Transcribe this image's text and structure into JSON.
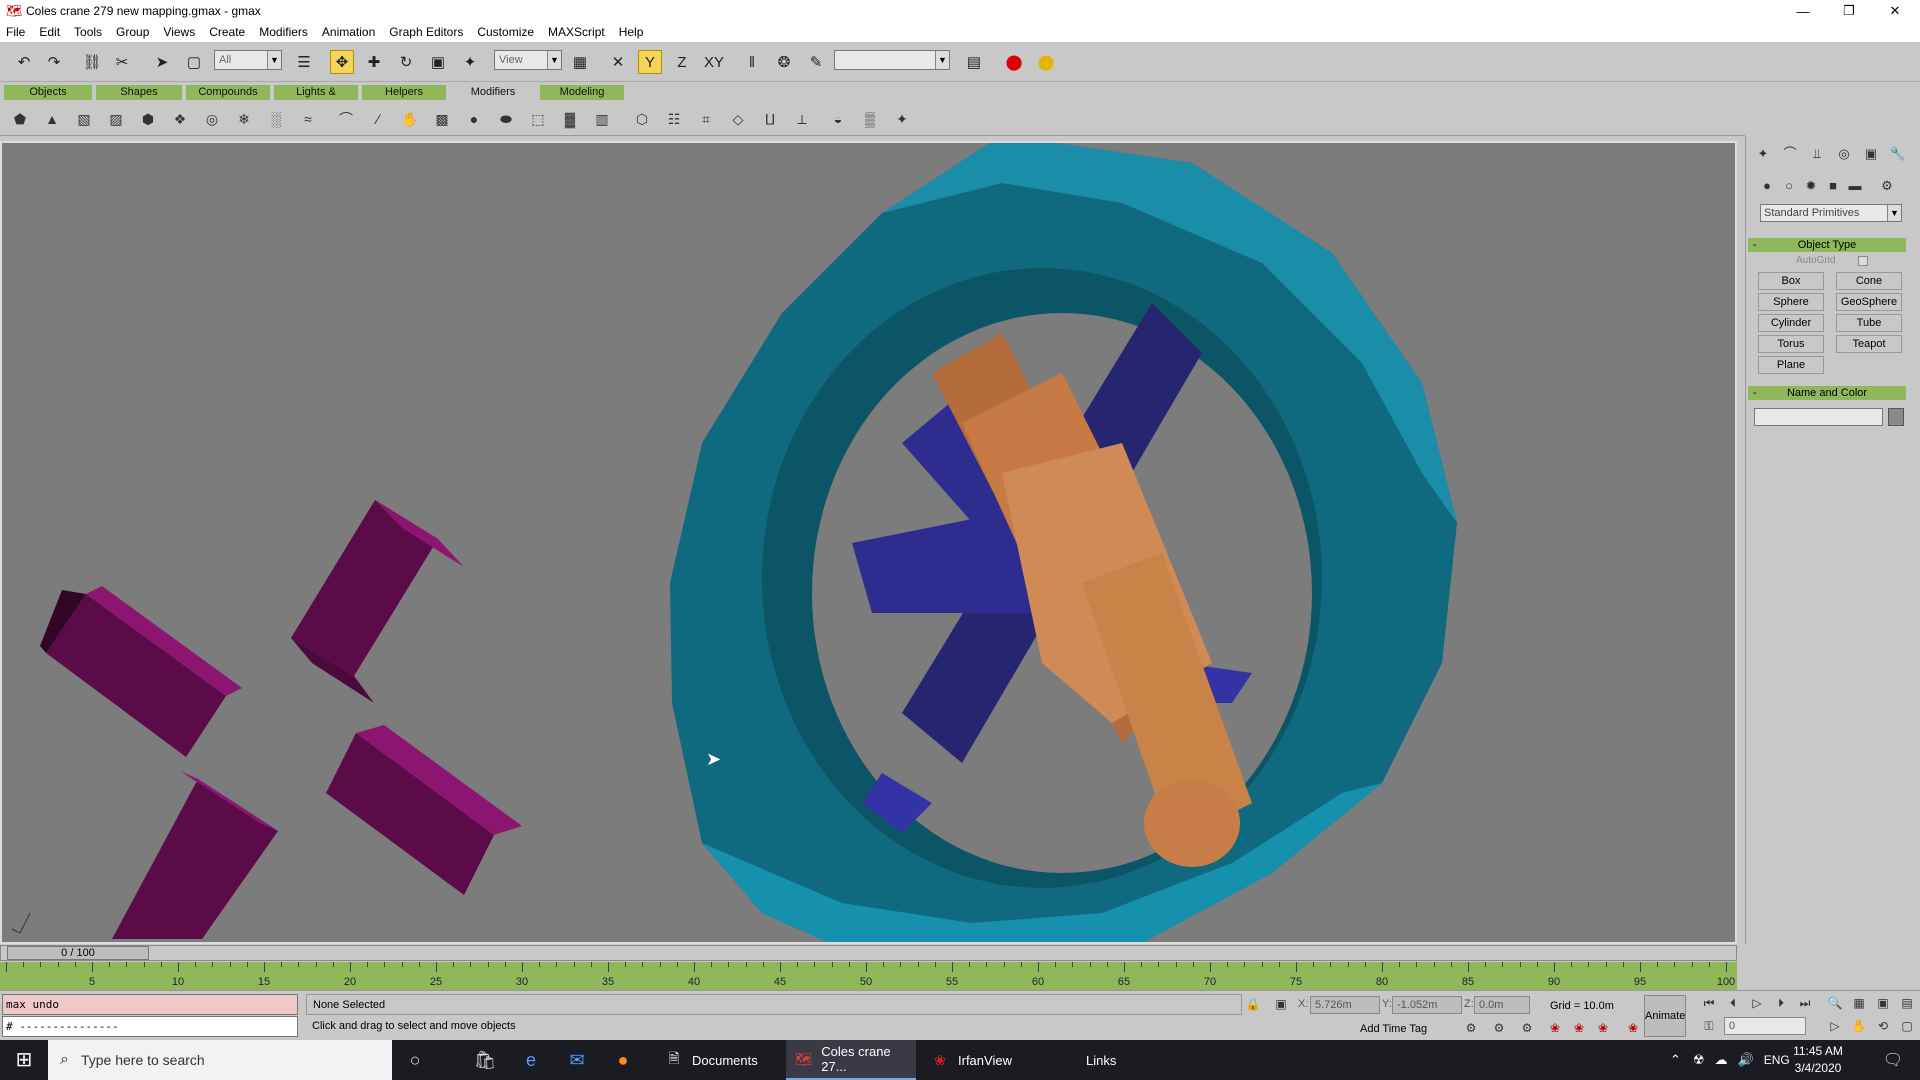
{
  "window": {
    "title": "Coles crane 279 new mapping.gmax - gmax",
    "controls": [
      "—",
      "❐",
      "✕"
    ]
  },
  "menu": [
    "File",
    "Edit",
    "Tools",
    "Group",
    "Views",
    "Create",
    "Modifiers",
    "Animation",
    "Graph Editors",
    "Customize",
    "MAXScript",
    "Help"
  ],
  "toolbar": {
    "selection_filter": "All",
    "reference_coord": "View",
    "named_selection": ""
  },
  "tabs": [
    "Objects",
    "Shapes",
    "Compounds",
    "Lights & Cameras",
    "Helpers",
    "Modifiers",
    "Modeling"
  ],
  "tabs_selected": "Modifiers",
  "command_panel": {
    "category": "Standard Primitives",
    "object_type_title": "Object Type",
    "autogrid_label": "AutoGrid",
    "buttons": [
      "Box",
      "Cone",
      "Sphere",
      "GeoSphere",
      "Cylinder",
      "Tube",
      "Torus",
      "Teapot",
      "Plane"
    ],
    "name_color_title": "Name and Color",
    "name_value": ""
  },
  "time": {
    "slider_label": "0 / 100",
    "ticks": [
      "5",
      "10",
      "15",
      "20",
      "25",
      "30",
      "35",
      "40",
      "45",
      "50",
      "55",
      "60",
      "65",
      "70",
      "75",
      "80",
      "85",
      "90",
      "95",
      "100"
    ]
  },
  "status": {
    "maxscript_line1": "max undo",
    "maxscript_line2": "# ---------------",
    "selection": "None Selected",
    "prompt": "Click and drag to select and move objects",
    "x_label": "X:",
    "x_value": "5.726m",
    "y_label": "Y:",
    "y_value": "-1.052m",
    "z_label": "Z:",
    "z_value": "0.0m",
    "grid": "Grid = 10.0m",
    "add_time_tag": "Add Time Tag",
    "animate": "Animate",
    "frame": "0"
  },
  "taskbar": {
    "search_placeholder": "Type here to search",
    "apps": [
      {
        "label": "Documents",
        "active": false
      },
      {
        "label": "Coles crane 27...",
        "active": true
      },
      {
        "label": "IrfanView",
        "active": false
      }
    ],
    "links": "Links",
    "lang": "ENG",
    "time": "11:45 AM",
    "date": "3/4/2020"
  },
  "colors": {
    "ui_grey": "#c8c8c8",
    "tab_green": "#8fb85a",
    "viewport_bg": "#7c7c7c",
    "wheel_teal": "#127a90",
    "hub_blue": "#2e2d8f",
    "axle_orange": "#c87a45",
    "block_purple": "#6a0e55"
  }
}
